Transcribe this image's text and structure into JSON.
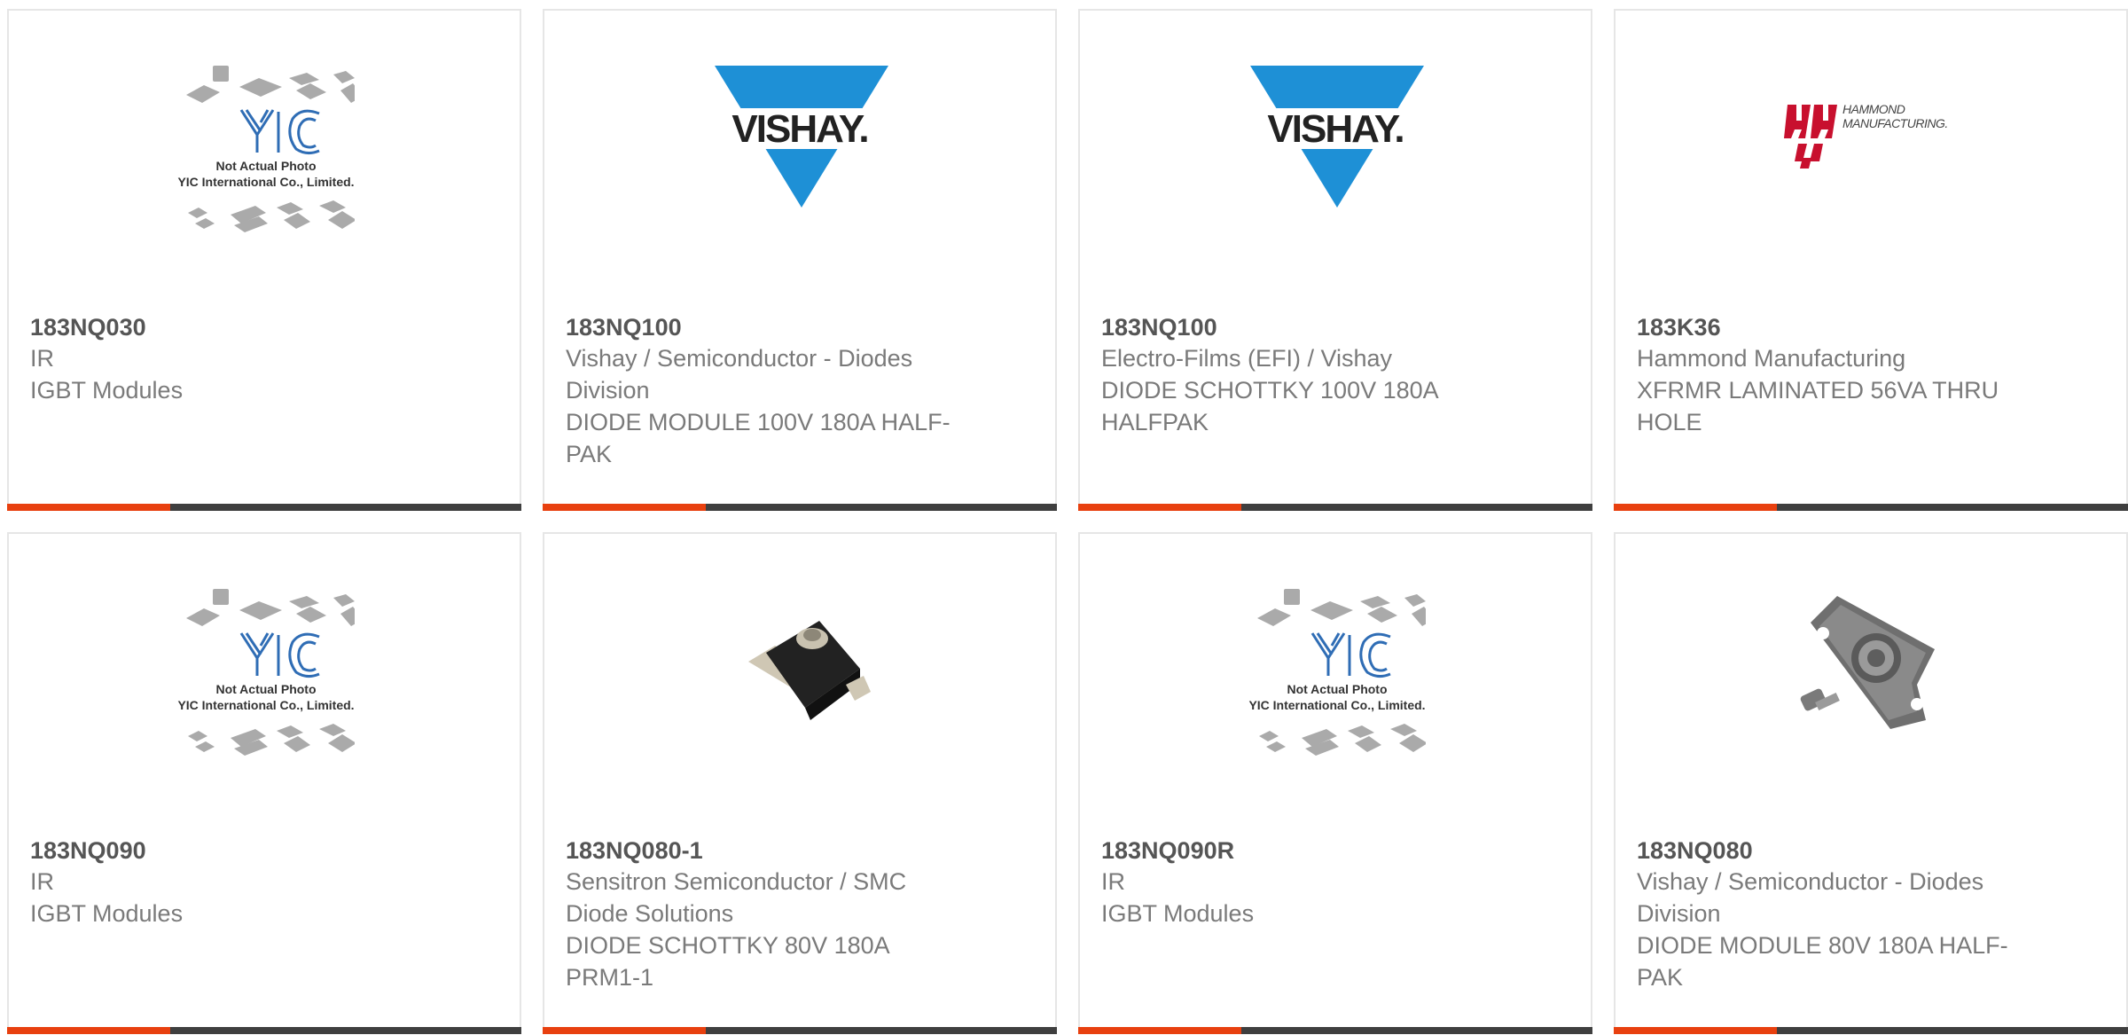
{
  "colors": {
    "accent_bar": "#e8400f",
    "dark_bar": "#3f3f3f",
    "vishay_blue": "#1e90d6",
    "hammond_red": "#c8102e"
  },
  "products": [
    {
      "part_number": "183NQ030",
      "lines": [
        "IR",
        "IGBT Modules"
      ],
      "image": "yic-placeholder",
      "image_text": [
        "Not Actual Photo",
        "YIC International Co., Limited."
      ]
    },
    {
      "part_number": "183NQ100",
      "lines": [
        "Vishay / Semiconductor - Diodes Division",
        "DIODE MODULE 100V 180A HALF-PAK"
      ],
      "image": "vishay-logo",
      "image_text": [
        "VISHAY."
      ]
    },
    {
      "part_number": "183NQ100",
      "lines": [
        "Electro-Films (EFI) / Vishay",
        "DIODE SCHOTTKY 100V 180A HALFPAK"
      ],
      "image": "vishay-logo",
      "image_text": [
        "VISHAY."
      ]
    },
    {
      "part_number": "183K36",
      "lines": [
        "Hammond Manufacturing",
        "XFRMR LAMINATED 56VA THRU HOLE"
      ],
      "image": "hammond-logo",
      "image_text": [
        "HAMMOND",
        "MANUFACTURING."
      ]
    },
    {
      "part_number": "183NQ090",
      "lines": [
        "IR",
        "IGBT Modules"
      ],
      "image": "yic-placeholder",
      "image_text": [
        "Not Actual Photo",
        "YIC International Co., Limited."
      ]
    },
    {
      "part_number": "183NQ080-1",
      "lines": [
        "Sensitron Semiconductor / SMC Diode Solutions",
        "DIODE SCHOTTKY 80V 180A PRM1-1"
      ],
      "image": "diode-photo-black",
      "image_text": []
    },
    {
      "part_number": "183NQ090R",
      "lines": [
        "IR",
        "IGBT Modules"
      ],
      "image": "yic-placeholder",
      "image_text": [
        "Not Actual Photo",
        "YIC International Co., Limited."
      ]
    },
    {
      "part_number": "183NQ080",
      "lines": [
        "Vishay / Semiconductor - Diodes Division",
        "DIODE MODULE 80V 180A HALF-PAK"
      ],
      "image": "diode-photo-metal",
      "image_text": []
    }
  ]
}
